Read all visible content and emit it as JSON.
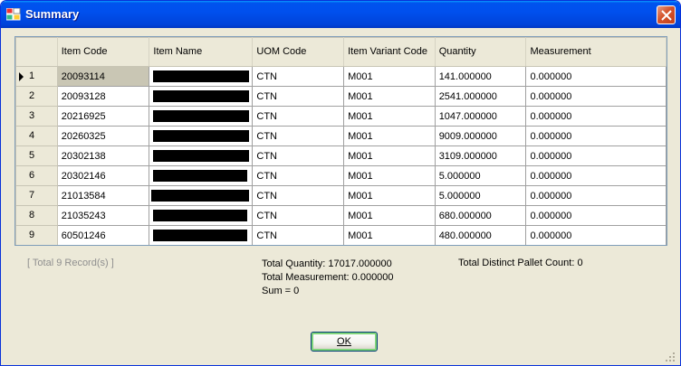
{
  "window": {
    "title": "Summary"
  },
  "grid": {
    "columns": [
      "Item Code",
      "Item Name",
      "UOM Code",
      "Item Variant Code",
      "Quantity",
      "Measurement"
    ],
    "rows": [
      {
        "num": "1",
        "code": "20093114",
        "name_redacted": true,
        "uom": "CTN",
        "variant": "M001",
        "qty": "141.000000",
        "meas": "0.000000"
      },
      {
        "num": "2",
        "code": "20093128",
        "name_redacted": true,
        "uom": "CTN",
        "variant": "M001",
        "qty": "2541.000000",
        "meas": "0.000000"
      },
      {
        "num": "3",
        "code": "20216925",
        "name_redacted": true,
        "uom": "CTN",
        "variant": "M001",
        "qty": "1047.000000",
        "meas": "0.000000"
      },
      {
        "num": "4",
        "code": "20260325",
        "name_redacted": true,
        "uom": "CTN",
        "variant": "M001",
        "qty": "9009.000000",
        "meas": "0.000000"
      },
      {
        "num": "5",
        "code": "20302138",
        "name_redacted": true,
        "uom": "CTN",
        "variant": "M001",
        "qty": "3109.000000",
        "meas": "0.000000"
      },
      {
        "num": "6",
        "code": "20302146",
        "name_redacted": true,
        "uom": "CTN",
        "variant": "M001",
        "qty": "5.000000",
        "meas": "0.000000"
      },
      {
        "num": "7",
        "code": "21013584",
        "name_redacted": true,
        "uom": "CTN",
        "variant": "M001",
        "qty": "5.000000",
        "meas": "0.000000"
      },
      {
        "num": "8",
        "code": "21035243",
        "name_redacted": true,
        "uom": "CTN",
        "variant": "M001",
        "qty": "680.000000",
        "meas": "0.000000"
      },
      {
        "num": "9",
        "code": "60501246",
        "name_redacted": true,
        "uom": "CTN",
        "variant": "M001",
        "qty": "480.000000",
        "meas": "0.000000"
      }
    ]
  },
  "footer": {
    "records": "[ Total 9 Record(s) ]",
    "total_quantity": "Total Quantity: 17017.000000",
    "total_measurement": "Total Measurement: 0.000000",
    "sum": "Sum = 0",
    "pallet_count": "Total Distinct Pallet Count: 0"
  },
  "buttons": {
    "ok": "OK"
  },
  "colors": {
    "titlebar": "#0053ee",
    "window_bg": "#ece9d8",
    "close": "#d5532b"
  }
}
